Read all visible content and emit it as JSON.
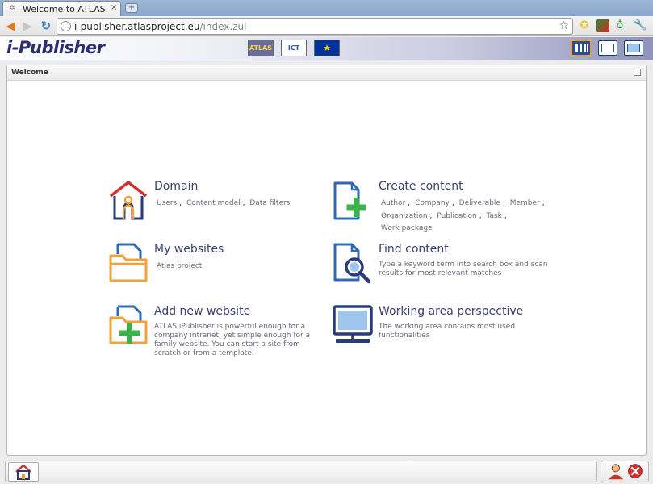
{
  "browser": {
    "tab_title": "Welcome to ATLAS",
    "tab_close": "×",
    "new_tab": "+",
    "url_host": "i-publisher.atlasproject.eu",
    "url_path": "/index.zul"
  },
  "app": {
    "logo": "i-Publisher",
    "partners": [
      "ATLAS",
      "ICT",
      "★"
    ]
  },
  "panel": {
    "title": "Welcome"
  },
  "tiles": {
    "domain": {
      "title": "Domain",
      "links": [
        "Users",
        "Content model",
        "Data filters"
      ]
    },
    "create": {
      "title": "Create content",
      "links": [
        "Author",
        "Company",
        "Deliverable",
        "Member",
        "Organization",
        "Publication",
        "Task",
        "Work package"
      ]
    },
    "websites": {
      "title": "My websites",
      "links": [
        "Atlas project"
      ]
    },
    "find": {
      "title": "Find content",
      "description": "Type a keyword term into search box and scan results for most relevant matches"
    },
    "addsite": {
      "title": "Add new website",
      "description": "ATLAS iPublisher is powerful enough for a company intranet, yet simple enough for a family website. You can start a site from scratch or from a template."
    },
    "working": {
      "title": "Working area perspective",
      "description": "The working area contains most used functionalities"
    }
  },
  "colors": {
    "brand": "#2a2d6e",
    "icon_blue": "#2f68b3",
    "icon_orange": "#f2a23a",
    "icon_green": "#3cb34a",
    "icon_red": "#d6312b"
  }
}
